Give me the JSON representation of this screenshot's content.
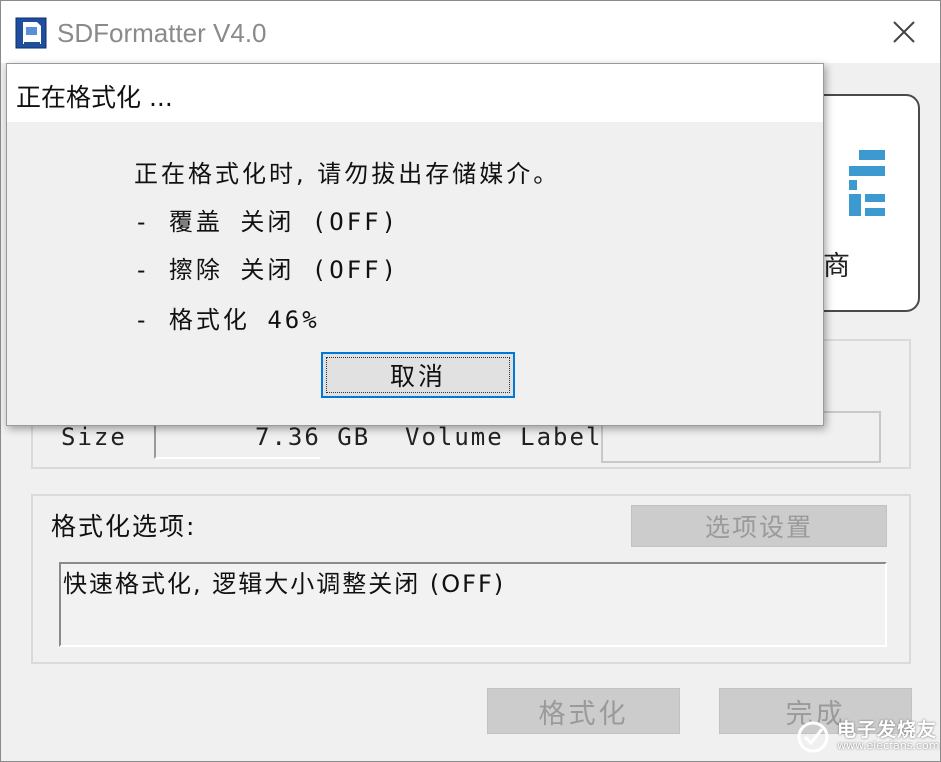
{
  "window": {
    "title": "SDFormatter V4.0"
  },
  "brand": {
    "label": "商"
  },
  "drive_info": {
    "size_label": "Size",
    "size_value": "7.36 GB",
    "volume_label": "Volume Label",
    "volume_value": ""
  },
  "format_options": {
    "title": "格式化选项:",
    "settings_button": "选项设置",
    "summary": "快速格式化, 逻辑大小调整关闭 (OFF)"
  },
  "buttons": {
    "format": "格式化",
    "done": "完成"
  },
  "watermark": {
    "text": "电子发烧友",
    "url": "www.elecfans.com"
  },
  "progress_dialog": {
    "title": "正在格式化 ...",
    "warning": "正在格式化时, 请勿拔出存储媒介。",
    "overwrite": "- 覆盖 关闭 (OFF)",
    "erase": "- 擦除 关闭 (OFF)",
    "format_progress": "- 格式化  46%",
    "progress_percent": 46,
    "cancel_button": "取消"
  },
  "colors": {
    "accent": "#0078d7",
    "sd_logo": "#3d9ad1",
    "disabled_text": "#9a9a9a"
  }
}
